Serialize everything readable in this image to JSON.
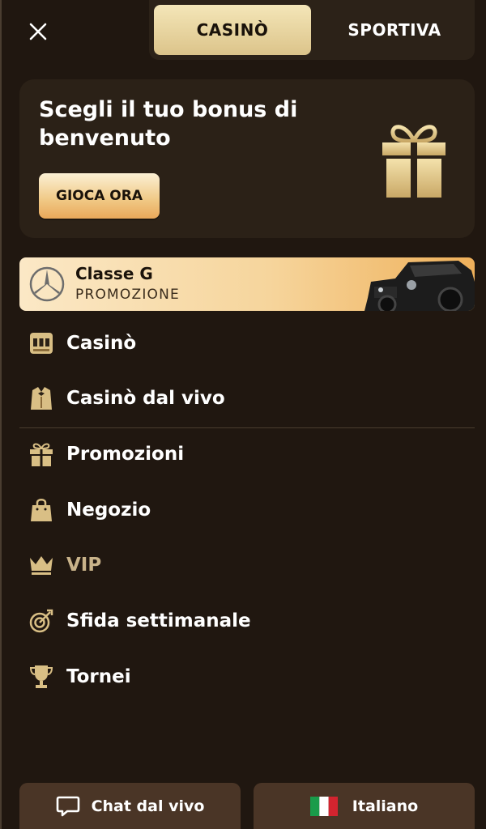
{
  "header": {
    "close_icon": "close-icon",
    "tabs": [
      {
        "label": "CASINÒ",
        "active": true
      },
      {
        "label": "SPORTIVA",
        "active": false
      }
    ]
  },
  "bonus": {
    "title": "Scegli il tuo bonus di benvenuto",
    "button_label": "GIOCA ORA",
    "icon": "gift-icon"
  },
  "promo": {
    "title": "Classe G",
    "subtitle": "PROMOZIONE",
    "logo_icon": "mercedes-logo-icon",
    "image": "car-image"
  },
  "menu": {
    "items": [
      {
        "label": "Casinò",
        "icon": "slot-machine-icon"
      },
      {
        "label": "Casinò dal vivo",
        "icon": "dealer-icon"
      },
      {
        "label": "Promozioni",
        "icon": "gift-icon"
      },
      {
        "label": "Negozio",
        "icon": "shopping-bag-icon"
      },
      {
        "label": "VIP",
        "icon": "crown-icon"
      },
      {
        "label": "Sfida settimanale",
        "icon": "target-icon"
      },
      {
        "label": "Tornei",
        "icon": "trophy-icon"
      }
    ]
  },
  "footer": {
    "chat_label": "Chat dal vivo",
    "chat_icon": "chat-bubble-icon",
    "language_label": "Italiano",
    "language_icon": "italy-flag-icon"
  },
  "colors": {
    "background": "#201710",
    "card": "#2b2117",
    "gold": "#e8cf94",
    "accent_orange": "#efb05a",
    "vip_text": "#c9b38a",
    "footer_button": "#4a3526"
  }
}
